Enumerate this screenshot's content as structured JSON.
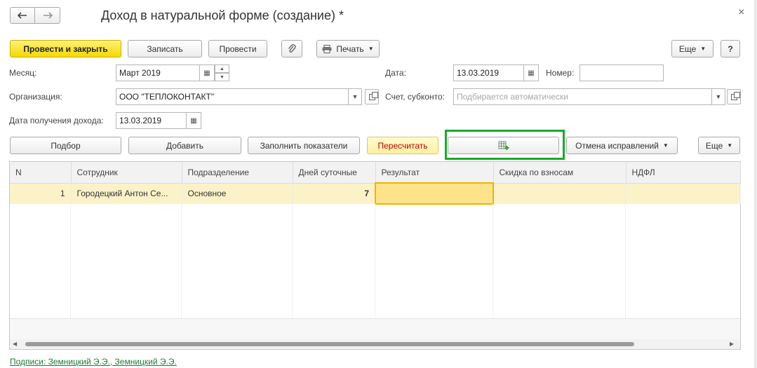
{
  "window": {
    "title": "Доход в натуральной форме (создание) *",
    "back_icon": "arrow-left-icon",
    "forward_icon": "arrow-right-icon",
    "close_glyph": "×"
  },
  "toolbar": {
    "post_close_label": "Провести и закрыть",
    "save_label": "Записать",
    "post_label": "Провести",
    "print_label": "Печать",
    "more_label": "Еще",
    "help_label": "?"
  },
  "form": {
    "month_label": "Месяц:",
    "month_value": "Март 2019",
    "date_label": "Дата:",
    "date_value": "13.03.2019",
    "number_label": "Номер:",
    "number_value": "",
    "org_label": "Организация:",
    "org_value": "ООО \"ТЕПЛОКОНТАКТ\"",
    "account_label": "Счет, субконто:",
    "account_placeholder": "Подбирается автоматически",
    "income_date_label": "Дата получения дохода:",
    "income_date_value": "13.03.2019"
  },
  "table_toolbar": {
    "pick_label": "Подбор",
    "add_label": "Добавить",
    "fill_label": "Заполнить показатели",
    "recalc_label": "Пересчитать",
    "cancel_fix_label": "Отмена исправлений",
    "more_label": "Еще",
    "highlight_color": "#1aaa2a"
  },
  "table": {
    "columns": [
      "N",
      "Сотрудник",
      "Подразделение",
      "Дней суточные",
      "Результат",
      "Скидка по взносам",
      "НДФЛ"
    ],
    "rows": [
      {
        "n": "1",
        "employee": "Городецкий Антон Се...",
        "department": "Основное",
        "days": "7",
        "result": "",
        "discount": "",
        "ndfl": ""
      }
    ]
  },
  "footer": {
    "signatures": "Подписи: Земницкий Э.Э., Земницкий Э.Э."
  }
}
